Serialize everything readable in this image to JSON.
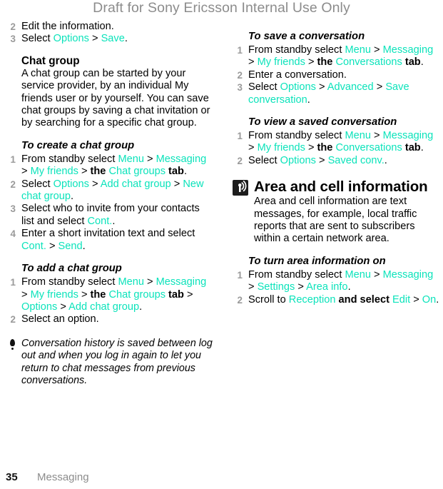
{
  "draft_notice": "Draft for Sony Ericsson Internal Use Only",
  "footer": {
    "page_number": "35",
    "chapter": "Messaging"
  },
  "colors": {
    "link": "#0ce3bb",
    "step_number": "#9a9a9a",
    "draft_notice": "#8c8c8c",
    "icon_background": "#1d1d1d"
  },
  "left_column": {
    "steps_top": [
      {
        "num": "2",
        "parts": [
          {
            "t": "Edit the information.",
            "s": "plain"
          }
        ]
      },
      {
        "num": "3",
        "parts": [
          {
            "t": "Select ",
            "s": "plain"
          },
          {
            "t": "Options",
            "s": "link"
          },
          {
            "t": " > ",
            "s": "plain"
          },
          {
            "t": "Save",
            "s": "link"
          },
          {
            "t": ".",
            "s": "plain"
          }
        ]
      }
    ],
    "chat_group": {
      "heading": "Chat group",
      "body": "A chat group can be started by your service provider, by an individual My friends user or by yourself. You can save chat groups by saving a chat invitation or by searching for a specific chat group."
    },
    "create_chat_group": {
      "heading": "To create a chat group",
      "steps": [
        {
          "num": "1",
          "parts": [
            {
              "t": "From standby select ",
              "s": "plain"
            },
            {
              "t": "Menu",
              "s": "link"
            },
            {
              "t": " > ",
              "s": "plain"
            },
            {
              "t": "Messaging",
              "s": "link"
            },
            {
              "t": " > ",
              "s": "plain"
            },
            {
              "t": "My friends",
              "s": "link"
            },
            {
              "t": " > ",
              "s": "plain"
            },
            {
              "t": "the ",
              "s": "bold"
            },
            {
              "t": "Chat groups",
              "s": "link"
            },
            {
              "t": " tab",
              "s": "bold"
            },
            {
              "t": ".",
              "s": "plain"
            }
          ]
        },
        {
          "num": "2",
          "parts": [
            {
              "t": "Select ",
              "s": "plain"
            },
            {
              "t": "Options",
              "s": "link"
            },
            {
              "t": " > ",
              "s": "plain"
            },
            {
              "t": "Add chat group",
              "s": "link"
            },
            {
              "t": " > ",
              "s": "plain"
            },
            {
              "t": "New chat group",
              "s": "link"
            },
            {
              "t": ".",
              "s": "plain"
            }
          ]
        },
        {
          "num": "3",
          "parts": [
            {
              "t": "Select who to invite from your contacts list and select ",
              "s": "plain"
            },
            {
              "t": "Cont.",
              "s": "link"
            },
            {
              "t": ".",
              "s": "plain"
            }
          ]
        },
        {
          "num": "4",
          "parts": [
            {
              "t": "Enter a short invitation text and select ",
              "s": "plain"
            },
            {
              "t": "Cont.",
              "s": "link"
            },
            {
              "t": " > ",
              "s": "plain"
            },
            {
              "t": "Send",
              "s": "link"
            },
            {
              "t": ".",
              "s": "plain"
            }
          ]
        }
      ]
    },
    "add_chat_group": {
      "heading": "To add a chat group",
      "steps": [
        {
          "num": "1",
          "parts": [
            {
              "t": "From standby select ",
              "s": "plain"
            },
            {
              "t": "Menu",
              "s": "link"
            },
            {
              "t": " > ",
              "s": "plain"
            },
            {
              "t": "Messaging",
              "s": "link"
            },
            {
              "t": " > ",
              "s": "plain"
            },
            {
              "t": "My friends",
              "s": "link"
            },
            {
              "t": " > ",
              "s": "plain"
            },
            {
              "t": "the ",
              "s": "bold"
            },
            {
              "t": "Chat groups",
              "s": "link"
            },
            {
              "t": " tab",
              "s": "bold"
            },
            {
              "t": " > ",
              "s": "plain"
            },
            {
              "t": "Options",
              "s": "link"
            },
            {
              "t": " > ",
              "s": "plain"
            },
            {
              "t": "Add chat group",
              "s": "link"
            },
            {
              "t": ".",
              "s": "plain"
            }
          ]
        },
        {
          "num": "2",
          "parts": [
            {
              "t": "Select an option.",
              "s": "plain"
            }
          ]
        }
      ]
    },
    "note": "Conversation history is saved between log out and when you log in again to let you return to chat messages from previous conversations."
  },
  "right_column": {
    "save_conversation": {
      "heading": "To save a conversation",
      "steps": [
        {
          "num": "1",
          "parts": [
            {
              "t": "From standby select ",
              "s": "plain"
            },
            {
              "t": "Menu",
              "s": "link"
            },
            {
              "t": " > ",
              "s": "plain"
            },
            {
              "t": "Messaging",
              "s": "link"
            },
            {
              "t": " > ",
              "s": "plain"
            },
            {
              "t": "My friends",
              "s": "link"
            },
            {
              "t": " > ",
              "s": "plain"
            },
            {
              "t": "the ",
              "s": "bold"
            },
            {
              "t": "Conversations",
              "s": "link"
            },
            {
              "t": " tab",
              "s": "bold"
            },
            {
              "t": ".",
              "s": "plain"
            }
          ]
        },
        {
          "num": "2",
          "parts": [
            {
              "t": "Enter a conversation.",
              "s": "plain"
            }
          ]
        },
        {
          "num": "3",
          "parts": [
            {
              "t": "Select ",
              "s": "plain"
            },
            {
              "t": "Options",
              "s": "link"
            },
            {
              "t": " > ",
              "s": "plain"
            },
            {
              "t": "Advanced",
              "s": "link"
            },
            {
              "t": " > ",
              "s": "plain"
            },
            {
              "t": "Save conversation",
              "s": "link"
            },
            {
              "t": ".",
              "s": "plain"
            }
          ]
        }
      ]
    },
    "view_saved_conversation": {
      "heading": "To view a saved conversation",
      "steps": [
        {
          "num": "1",
          "parts": [
            {
              "t": "From standby select ",
              "s": "plain"
            },
            {
              "t": "Menu",
              "s": "link"
            },
            {
              "t": " > ",
              "s": "plain"
            },
            {
              "t": "Messaging",
              "s": "link"
            },
            {
              "t": " > ",
              "s": "plain"
            },
            {
              "t": "My friends",
              "s": "link"
            },
            {
              "t": " > ",
              "s": "plain"
            },
            {
              "t": "the ",
              "s": "bold"
            },
            {
              "t": "Conversations",
              "s": "link"
            },
            {
              "t": " tab",
              "s": "bold"
            },
            {
              "t": ".",
              "s": "plain"
            }
          ]
        },
        {
          "num": "2",
          "parts": [
            {
              "t": "Select ",
              "s": "plain"
            },
            {
              "t": "Options",
              "s": "link"
            },
            {
              "t": " > ",
              "s": "plain"
            },
            {
              "t": "Saved conv.",
              "s": "link"
            },
            {
              "t": ".",
              "s": "plain"
            }
          ]
        }
      ]
    },
    "area_and_cell": {
      "icon": "broadcast-antenna-icon",
      "title": "Area and cell information",
      "body": "Area and cell information are text messages, for example, local traffic reports that are sent to subscribers within a certain network area."
    },
    "turn_area_info_on": {
      "heading": "To turn area information on",
      "steps": [
        {
          "num": "1",
          "parts": [
            {
              "t": "From standby select ",
              "s": "plain"
            },
            {
              "t": "Menu",
              "s": "link"
            },
            {
              "t": " > ",
              "s": "plain"
            },
            {
              "t": "Messaging",
              "s": "link"
            },
            {
              "t": " > ",
              "s": "plain"
            },
            {
              "t": "Settings",
              "s": "link"
            },
            {
              "t": " > ",
              "s": "plain"
            },
            {
              "t": "Area info",
              "s": "link"
            },
            {
              "t": ".",
              "s": "plain"
            }
          ]
        },
        {
          "num": "2",
          "parts": [
            {
              "t": "Scroll to ",
              "s": "plain"
            },
            {
              "t": "Reception",
              "s": "link"
            },
            {
              "t": " and select ",
              "s": "bold"
            },
            {
              "t": "Edit",
              "s": "link"
            },
            {
              "t": " > ",
              "s": "plain"
            },
            {
              "t": "On",
              "s": "link"
            },
            {
              "t": ".",
              "s": "plain"
            }
          ]
        }
      ]
    }
  }
}
